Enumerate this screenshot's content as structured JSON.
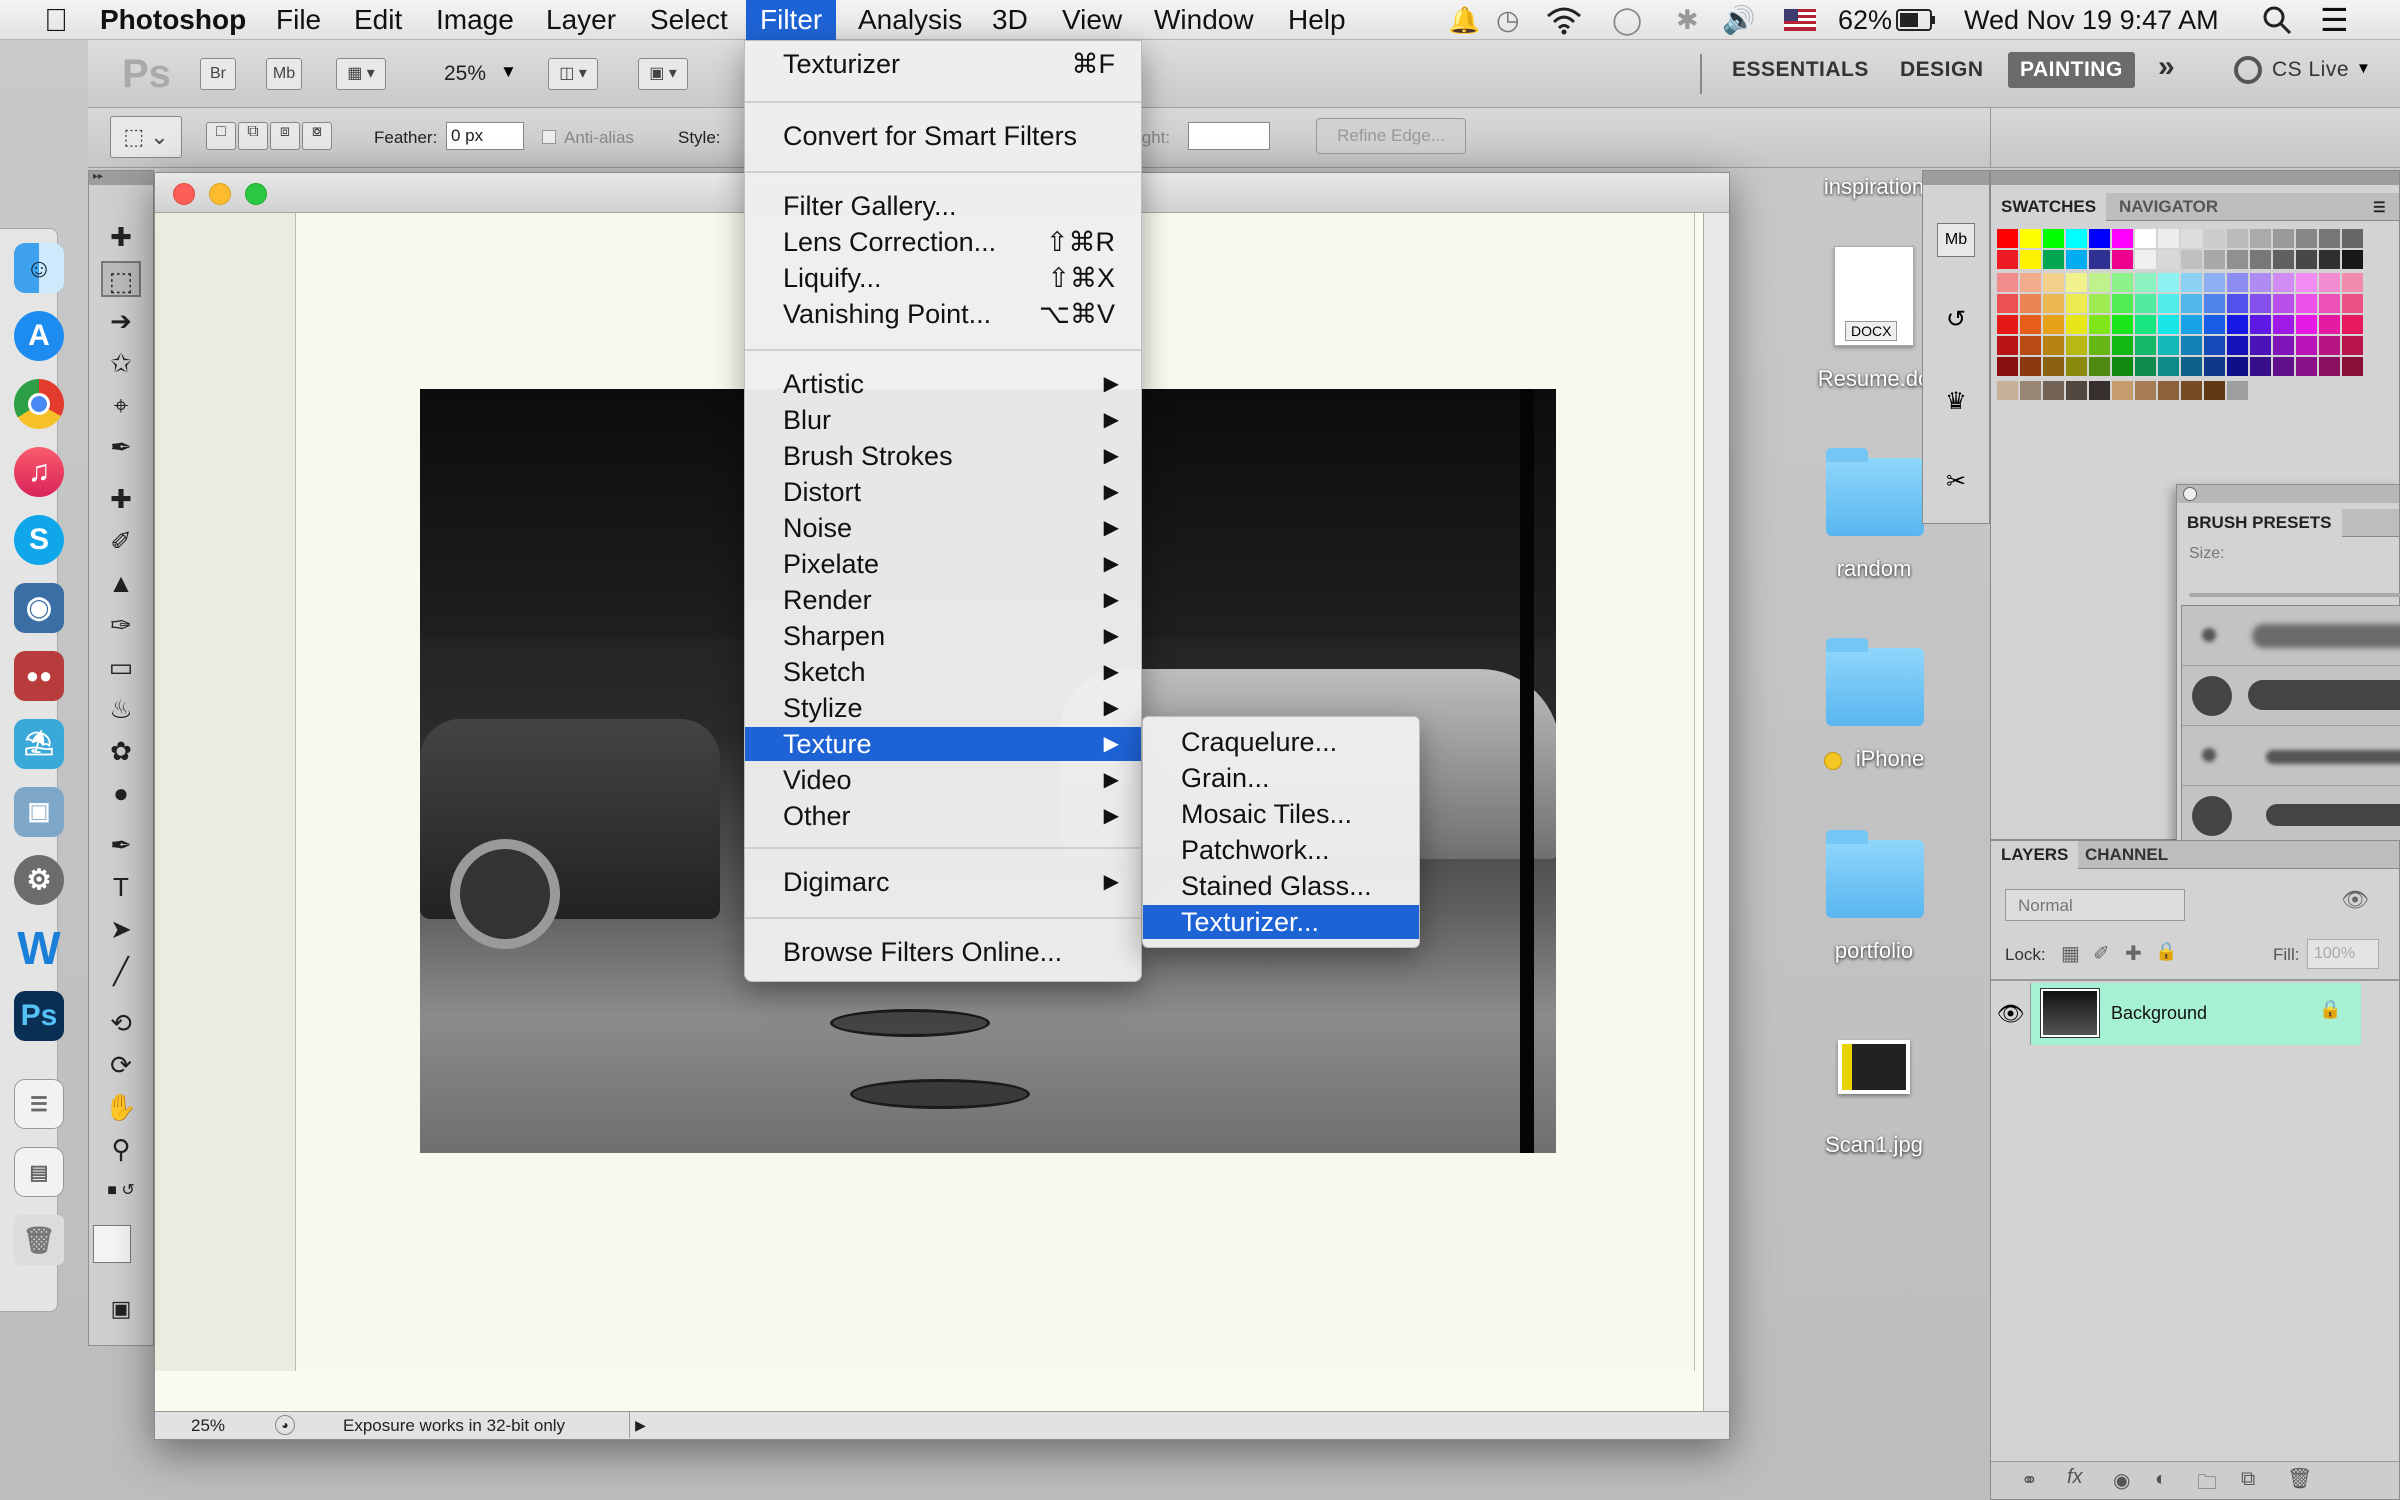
{
  "menubar": {
    "app_name": "Photoshop",
    "items": [
      "File",
      "Edit",
      "Image",
      "Layer",
      "Select",
      "Filter",
      "Analysis",
      "3D",
      "View",
      "Window",
      "Help"
    ],
    "active": "Filter",
    "status": {
      "battery": "62%",
      "datetime": "Wed Nov 19  9:47 AM"
    }
  },
  "appbar": {
    "ps_logo": "Ps",
    "br": "Br",
    "mb": "Mb",
    "zoom": "25%",
    "workspaces": [
      "ESSENTIALS",
      "DESIGN",
      "PAINTING"
    ],
    "active_workspace": "PAINTING",
    "more": "»",
    "cs_live": "CS Live"
  },
  "options": {
    "feather_label": "Feather:",
    "feather_value": "0 px",
    "antialias": "Anti-alias",
    "style_label": "Style:",
    "height_label": "ight:",
    "refine_edge": "Refine Edge..."
  },
  "filter_menu": {
    "items": [
      {
        "label": "Texturizer",
        "shortcut": "⌘F"
      },
      {
        "label": "Convert for Smart Filters"
      },
      {
        "label": "Filter Gallery..."
      },
      {
        "label": "Lens Correction...",
        "shortcut": "⇧⌘R"
      },
      {
        "label": "Liquify...",
        "shortcut": "⇧⌘X"
      },
      {
        "label": "Vanishing Point...",
        "shortcut": "⌥⌘V"
      },
      {
        "label": "Artistic"
      },
      {
        "label": "Blur"
      },
      {
        "label": "Brush Strokes"
      },
      {
        "label": "Distort"
      },
      {
        "label": "Noise"
      },
      {
        "label": "Pixelate"
      },
      {
        "label": "Render"
      },
      {
        "label": "Sharpen"
      },
      {
        "label": "Sketch"
      },
      {
        "label": "Stylize"
      },
      {
        "label": "Texture"
      },
      {
        "label": "Video"
      },
      {
        "label": "Other"
      },
      {
        "label": "Digimarc"
      },
      {
        "label": "Browse Filters Online..."
      }
    ]
  },
  "texture_submenu": {
    "items": [
      "Craquelure...",
      "Grain...",
      "Mosaic Tiles...",
      "Patchwork...",
      "Stained Glass...",
      "Texturizer..."
    ],
    "highlighted": "Texturizer..."
  },
  "document": {
    "zoom": "25%",
    "status_text": "Exposure works in 32-bit only"
  },
  "desktop_icons": [
    {
      "label": "inspiration"
    },
    {
      "label": "Resume.do",
      "badge": "DOCX"
    },
    {
      "label": "random"
    },
    {
      "label": "iPhone"
    },
    {
      "label": "portfolio"
    },
    {
      "label": "Scan1.jpg"
    }
  ],
  "panels": {
    "swatches_tab": "SWATCHES",
    "navigator_tab": "NAVIGATOR",
    "brush_presets_tab": "BRUSH PRESETS",
    "brush_size_label": "Size:",
    "layers_tab": "LAYERS",
    "channels_tab": "CHANNEL",
    "blend_mode": "Normal",
    "lock_label": "Lock:",
    "fill_label": "Fill:",
    "fill_value": "100%",
    "layer_name": "Background"
  },
  "colors": {
    "menu_highlight": "#1e63d6",
    "layer_selected": "#a6f0d3",
    "folder_blue": "#6ec4f5"
  },
  "icons": [
    "apple-icon",
    "bell-icon",
    "time-machine-icon",
    "wifi-icon",
    "bluetooth-icon",
    "volume-icon",
    "flag-icon",
    "battery-icon",
    "search-icon",
    "list-icon",
    "finder-icon",
    "app-store-icon",
    "chrome-icon",
    "itunes-icon",
    "skype-icon",
    "photoshop-icon",
    "eye-icon",
    "lock-icon"
  ]
}
